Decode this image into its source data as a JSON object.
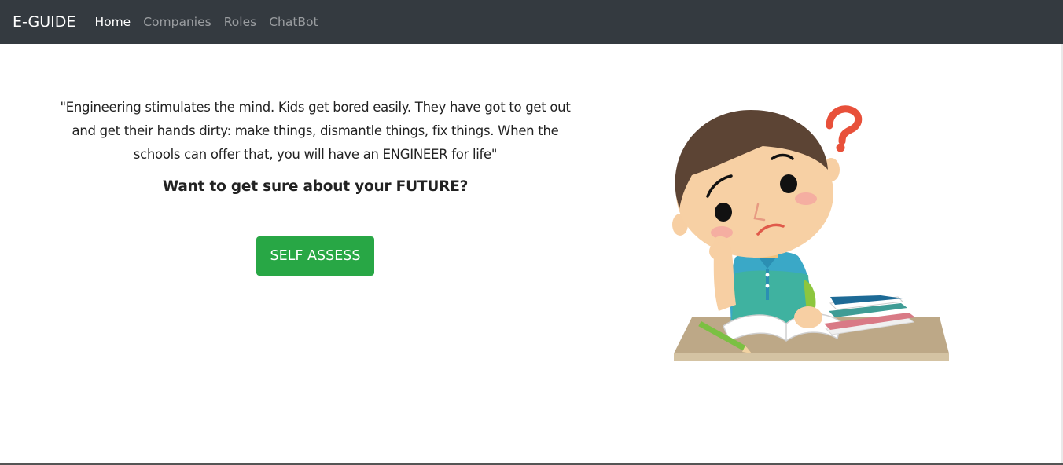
{
  "navbar": {
    "brand": "E-GUIDE",
    "links": [
      {
        "label": "Home",
        "active": true
      },
      {
        "label": "Companies",
        "active": false
      },
      {
        "label": "Roles",
        "active": false
      },
      {
        "label": "ChatBot",
        "active": false
      }
    ]
  },
  "hero": {
    "quote": "\"Engineering stimulates the mind. Kids get bored easily. They have got to get out and get their hands dirty: make things, dismantle things, fix things. When the schools can offer that, you will have an ENGINEER for life\"",
    "tagline": "Want to get sure about your FUTURE?",
    "button_label": "SELF ASSESS",
    "illustration": "thinking-student-at-desk"
  },
  "colors": {
    "navbar_bg": "#343a40",
    "button_green": "#28a745"
  }
}
